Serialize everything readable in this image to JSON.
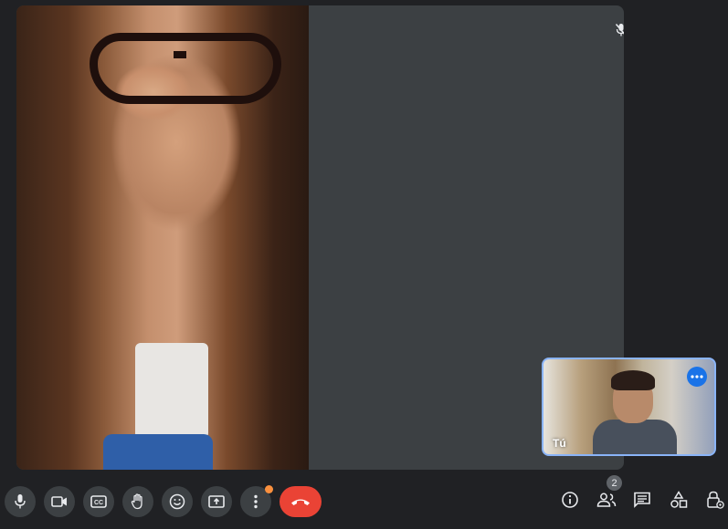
{
  "meeting": {
    "self_tile": {
      "label": "Tú"
    },
    "participants_count": "2"
  },
  "controls": {
    "left": [
      {
        "name": "microphone-icon"
      },
      {
        "name": "camera-icon"
      },
      {
        "name": "captions-icon"
      },
      {
        "name": "raise-hand-icon"
      },
      {
        "name": "reactions-icon"
      },
      {
        "name": "present-screen-icon"
      },
      {
        "name": "more-options-icon"
      },
      {
        "name": "end-call-icon"
      }
    ],
    "right": [
      {
        "name": "meeting-info-icon"
      },
      {
        "name": "people-icon"
      },
      {
        "name": "chat-icon"
      },
      {
        "name": "activities-icon"
      },
      {
        "name": "host-controls-icon"
      }
    ]
  },
  "colors": {
    "end_call": "#ea4335",
    "accent": "#1a73e8",
    "self_border": "#8ab4f8",
    "notification_dot": "#fa903e"
  }
}
